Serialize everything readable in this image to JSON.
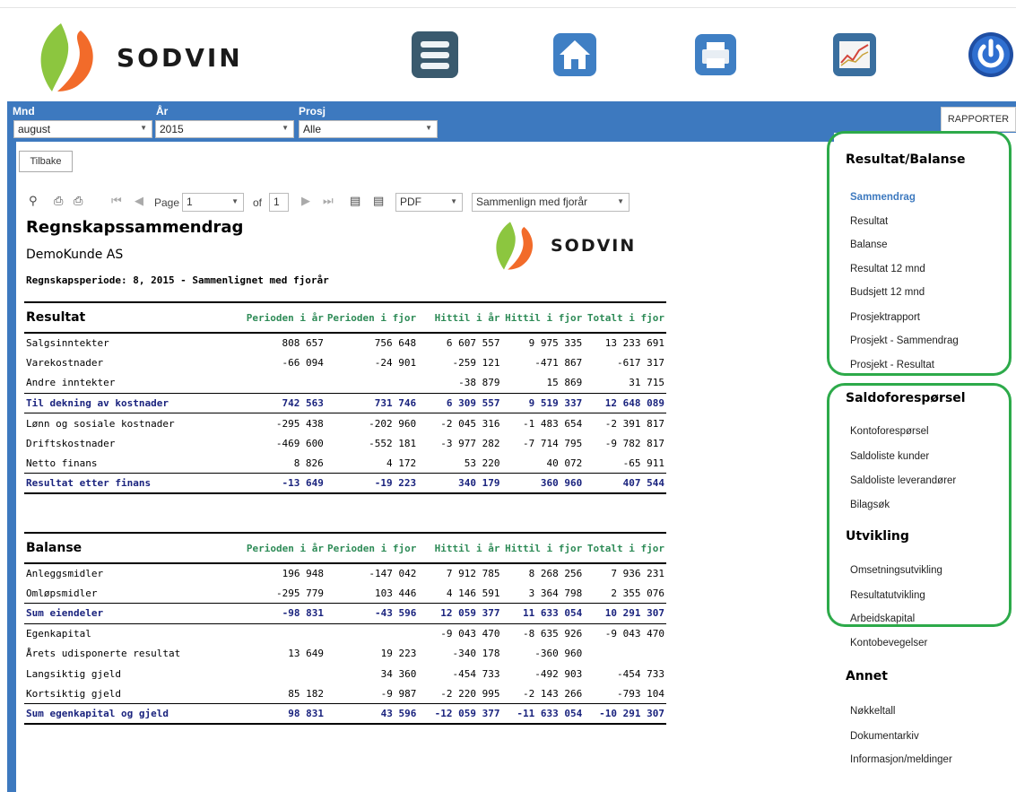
{
  "header": {
    "brand": "SODVIN",
    "icons": [
      "menu-icon",
      "home-icon",
      "print-icon",
      "chart-icon",
      "power-icon"
    ]
  },
  "filters": {
    "month_label": "Mnd",
    "month_value": "august",
    "year_label": "År",
    "year_value": "2015",
    "project_label": "Prosj",
    "project_value": "Alle"
  },
  "rapporter_button": "RAPPORTER",
  "back_button": "Tilbake",
  "toolbar": {
    "page_label": "Page",
    "page_value": "1",
    "of_label": "of",
    "total_pages": "1",
    "format_value": "PDF",
    "compare_value": "Sammenlign med fjorår"
  },
  "report": {
    "title": "Regnskapssammendrag",
    "customer": "DemoKunde AS",
    "period": "Regnskapsperiode: 8, 2015 - Sammenlignet med fjorår",
    "logo_text": "SODVIN",
    "columns": [
      "Perioden i år",
      "Perioden i fjor",
      "Hittil i år",
      "Hittil i fjor",
      "Totalt i fjor"
    ],
    "resultat": {
      "heading": "Resultat",
      "rows": [
        {
          "label": "Salgsinntekter",
          "values": [
            "808 657",
            "756 648",
            "6 607 557",
            "9 975 335",
            "13 233 691"
          ],
          "sum": false
        },
        {
          "label": "Varekostnader",
          "values": [
            "-66 094",
            "-24 901",
            "-259 121",
            "-471 867",
            "-617 317"
          ],
          "sum": false
        },
        {
          "label": "Andre inntekter",
          "values": [
            "",
            "",
            "-38 879",
            "15 869",
            "31 715"
          ],
          "sum": false
        },
        {
          "label": "Til dekning av kostnader",
          "values": [
            "742 563",
            "731 746",
            "6 309 557",
            "9 519 337",
            "12 648 089"
          ],
          "sum": true
        },
        {
          "label": "Lønn og sosiale kostnader",
          "values": [
            "-295 438",
            "-202 960",
            "-2 045 316",
            "-1 483 654",
            "-2 391 817"
          ],
          "sum": false
        },
        {
          "label": "Driftskostnader",
          "values": [
            "-469 600",
            "-552 181",
            "-3 977 282",
            "-7 714 795",
            "-9 782 817"
          ],
          "sum": false
        },
        {
          "label": "Netto finans",
          "values": [
            "8 826",
            "4 172",
            "53 220",
            "40 072",
            "-65 911"
          ],
          "sum": false
        },
        {
          "label": "Resultat etter finans",
          "values": [
            "-13 649",
            "-19 223",
            "340 179",
            "360 960",
            "407 544"
          ],
          "sum": true
        }
      ]
    },
    "balanse": {
      "heading": "Balanse",
      "rows": [
        {
          "label": "Anleggsmidler",
          "values": [
            "196 948",
            "-147 042",
            "7 912 785",
            "8 268 256",
            "7 936 231"
          ],
          "sum": false
        },
        {
          "label": "Omløpsmidler",
          "values": [
            "-295 779",
            "103 446",
            "4 146 591",
            "3 364 798",
            "2 355 076"
          ],
          "sum": false
        },
        {
          "label": "Sum eiendeler",
          "values": [
            "-98 831",
            "-43 596",
            "12 059 377",
            "11 633 054",
            "10 291 307"
          ],
          "sum": true
        },
        {
          "label": "Egenkapital",
          "values": [
            "",
            "",
            "-9 043 470",
            "-8 635 926",
            "-9 043 470"
          ],
          "sum": false
        },
        {
          "label": "Årets udisponerte resultat",
          "values": [
            "13 649",
            "19 223",
            "-340 178",
            "-360 960",
            ""
          ],
          "sum": false
        },
        {
          "label": "Langsiktig gjeld",
          "values": [
            "",
            "34 360",
            "-454 733",
            "-492 903",
            "-454 733"
          ],
          "sum": false
        },
        {
          "label": "Kortsiktig gjeld",
          "values": [
            "85 182",
            "-9 987",
            "-2 220 995",
            "-2 143 266",
            "-793 104"
          ],
          "sum": false
        },
        {
          "label": "Sum egenkapital og gjeld",
          "values": [
            "98 831",
            "43 596",
            "-12 059 377",
            "-11 633 054",
            "-10 291 307"
          ],
          "sum": true
        }
      ]
    }
  },
  "menu": {
    "sections": [
      {
        "title": "Resultat/Balanse",
        "items": [
          "Sammendrag",
          "Resultat",
          "Balanse",
          "Resultat 12 mnd",
          "Budsjett 12 mnd",
          "Prosjektrapport",
          "Prosjekt - Sammendrag",
          "Prosjekt - Resultat"
        ]
      },
      {
        "title": "Saldoforespørsel",
        "items": [
          "Kontoforespørsel",
          "Saldoliste kunder",
          "Saldoliste leverandører",
          "Bilagsøk"
        ]
      },
      {
        "title": "Utvikling",
        "items": [
          "Omsetningsutvikling",
          "Resultatutvikling",
          "Arbeidskapital",
          "Kontobevegelser"
        ]
      },
      {
        "title": "Annet",
        "items": [
          "Nøkkeltall",
          "Dokumentarkiv",
          "Informasjon/meldinger"
        ]
      }
    ],
    "active_item": "Sammendrag"
  },
  "colors": {
    "app_blue": "#3d79bf",
    "highlight_green": "#2daa4a",
    "column_green": "#2e8b57",
    "sum_navy": "#1a237e"
  }
}
